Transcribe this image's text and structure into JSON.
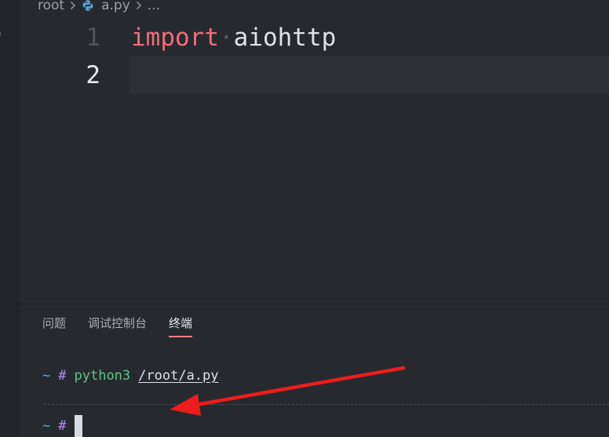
{
  "breadcrumb": {
    "root": "root",
    "file": "a.py",
    "more": "..."
  },
  "editor": {
    "lines": [
      {
        "number": "1",
        "keyword": "import",
        "dot": "·",
        "module": "aiohttp"
      },
      {
        "number": "2"
      }
    ],
    "line_number_color": "#4f555b",
    "current_line_number_color": "#e6e9ec"
  },
  "panel": {
    "tabs": [
      {
        "label": "问题"
      },
      {
        "label": "调试控制台"
      },
      {
        "label": "终端",
        "active": true
      }
    ]
  },
  "terminal": {
    "line1": {
      "dir": "~",
      "prompt": "#",
      "command": "python3",
      "argument": "/root/a.py"
    },
    "line2": {
      "dir": "~",
      "prompt": "#"
    }
  },
  "annotation": {
    "arrow_color": "#ee1c1c"
  }
}
